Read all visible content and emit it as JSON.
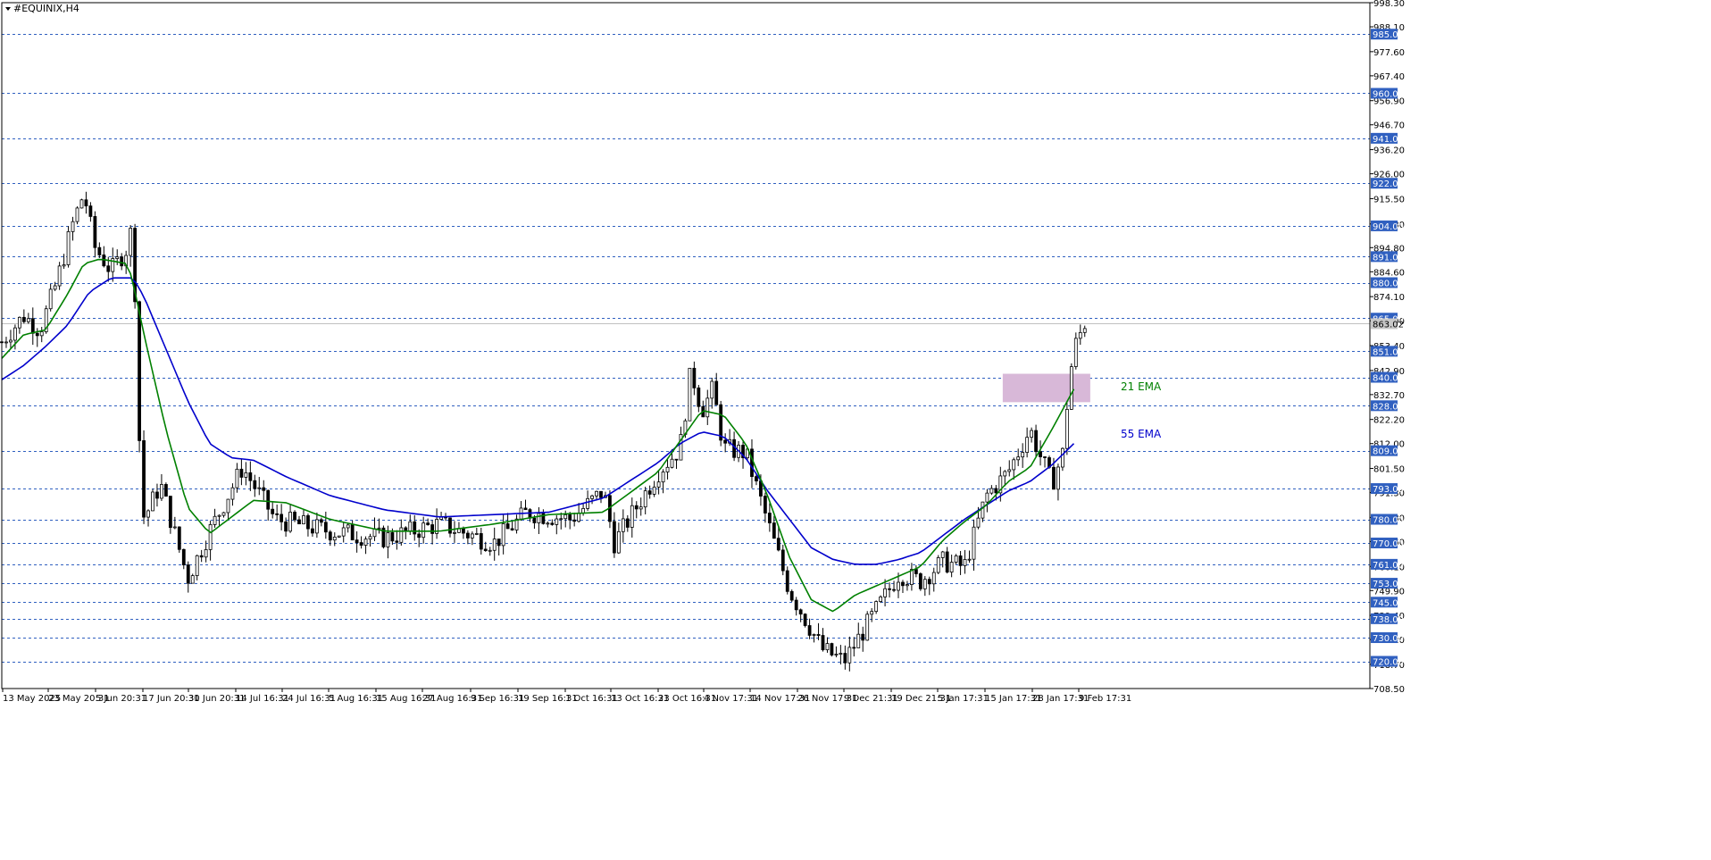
{
  "window": {
    "title": "#EQUINIX,H4"
  },
  "colors": {
    "background": "#ffffff",
    "grid_level": "#3060c0",
    "level_tag_bg": "#3060c0",
    "candle": "#000000",
    "ema21": "#008000",
    "ema55": "#0000cc",
    "zone": "#d8b8d8"
  },
  "chart_data": {
    "type": "candlestick",
    "symbol": "#EQUINIX",
    "timeframe": "H4",
    "ylim": [
      708.5,
      998.3
    ],
    "price_ticks": [
      "998.30",
      "988.10",
      "977.60",
      "967.40",
      "956.90",
      "946.70",
      "936.20",
      "926.00",
      "915.50",
      "904.80",
      "894.80",
      "884.60",
      "874.10",
      "863.90",
      "853.40",
      "842.90",
      "832.70",
      "822.20",
      "812.00",
      "801.50",
      "791.30",
      "780.80",
      "770.60",
      "760.10",
      "749.90",
      "739.40",
      "729.20",
      "718.70",
      "708.50"
    ],
    "price_tick_values": [
      998.3,
      988.1,
      977.6,
      967.4,
      956.9,
      946.7,
      936.2,
      926.0,
      915.5,
      904.8,
      894.8,
      884.6,
      874.1,
      863.9,
      853.4,
      842.9,
      832.7,
      822.2,
      812.0,
      801.5,
      791.3,
      780.8,
      770.6,
      760.1,
      749.9,
      739.4,
      729.2,
      718.7,
      708.5
    ],
    "levels": [
      "985.00",
      "960.00",
      "941.00",
      "922.00",
      "904.00",
      "891.00",
      "880.00",
      "865.00",
      "851.00",
      "840.00",
      "828.00",
      "809.00",
      "793.00",
      "780.00",
      "770.00",
      "761.00",
      "753.00",
      "745.00",
      "738.00",
      "730.00",
      "720.00"
    ],
    "level_values": [
      985,
      960,
      941,
      922,
      904,
      891,
      880,
      865,
      851,
      840,
      828,
      809,
      793,
      780,
      770,
      761,
      753,
      745,
      738,
      730,
      720
    ],
    "current_price": "863.02",
    "current_price_value": 863.02,
    "time_labels": [
      "13 May 2025",
      "23 May 20:31",
      "5 Jun 20:31",
      "17 Jun 20:31",
      "30 Jun 20:31",
      "14 Jul 16:31",
      "24 Jul 16:31",
      "5 Aug 16:31",
      "15 Aug 16:31",
      "27 Aug 16:31",
      "9 Sep 16:31",
      "19 Sep 16:31",
      "1 Oct 16:31",
      "13 Oct 16:31",
      "23 Oct 16:31",
      "4 Nov 17:31",
      "14 Nov 17:31",
      "26 Nov 17:31",
      "9 Dec 21:31",
      "19 Dec 21:31",
      "5 Jan 17:31",
      "15 Jan 17:31",
      "28 Jan 17:31",
      "9 Feb 17:31"
    ],
    "price_path": [
      [
        0,
        855
      ],
      [
        0.02,
        866
      ],
      [
        0.035,
        860
      ],
      [
        0.05,
        880
      ],
      [
        0.065,
        905
      ],
      [
        0.075,
        918
      ],
      [
        0.085,
        895
      ],
      [
        0.1,
        885
      ],
      [
        0.115,
        895
      ],
      [
        0.12,
        906
      ],
      [
        0.125,
        820
      ],
      [
        0.13,
        780
      ],
      [
        0.145,
        795
      ],
      [
        0.17,
        755
      ],
      [
        0.19,
        775
      ],
      [
        0.22,
        802
      ],
      [
        0.25,
        780
      ],
      [
        0.3,
        775
      ],
      [
        0.35,
        772
      ],
      [
        0.4,
        778
      ],
      [
        0.45,
        770
      ],
      [
        0.48,
        783
      ],
      [
        0.52,
        780
      ],
      [
        0.55,
        792
      ],
      [
        0.56,
        770
      ],
      [
        0.6,
        800
      ],
      [
        0.62,
        810
      ],
      [
        0.63,
        843
      ],
      [
        0.64,
        826
      ],
      [
        0.65,
        835
      ],
      [
        0.66,
        810
      ],
      [
        0.68,
        808
      ],
      [
        0.72,
        750
      ],
      [
        0.75,
        725
      ],
      [
        0.77,
        720
      ],
      [
        0.8,
        742
      ],
      [
        0.82,
        757
      ],
      [
        0.84,
        754
      ],
      [
        0.86,
        762
      ],
      [
        0.88,
        760
      ],
      [
        0.9,
        790
      ],
      [
        0.92,
        800
      ],
      [
        0.94,
        818
      ],
      [
        0.95,
        806
      ],
      [
        0.96,
        795
      ],
      [
        0.97,
        808
      ],
      [
        0.975,
        835
      ],
      [
        0.98,
        852
      ],
      [
        0.99,
        863
      ]
    ],
    "ema21_path": [
      [
        0,
        848
      ],
      [
        0.02,
        858
      ],
      [
        0.04,
        860
      ],
      [
        0.06,
        875
      ],
      [
        0.075,
        888
      ],
      [
        0.09,
        890
      ],
      [
        0.115,
        888
      ],
      [
        0.12,
        880
      ],
      [
        0.13,
        858
      ],
      [
        0.15,
        818
      ],
      [
        0.17,
        785
      ],
      [
        0.19,
        774
      ],
      [
        0.21,
        781
      ],
      [
        0.23,
        788
      ],
      [
        0.26,
        787
      ],
      [
        0.3,
        780
      ],
      [
        0.35,
        775
      ],
      [
        0.4,
        775
      ],
      [
        0.45,
        778
      ],
      [
        0.5,
        782
      ],
      [
        0.55,
        783
      ],
      [
        0.6,
        800
      ],
      [
        0.64,
        826
      ],
      [
        0.66,
        824
      ],
      [
        0.68,
        812
      ],
      [
        0.7,
        790
      ],
      [
        0.72,
        764
      ],
      [
        0.74,
        746
      ],
      [
        0.76,
        741
      ],
      [
        0.78,
        748
      ],
      [
        0.8,
        752
      ],
      [
        0.82,
        756
      ],
      [
        0.84,
        760
      ],
      [
        0.86,
        771
      ],
      [
        0.88,
        779
      ],
      [
        0.9,
        786
      ],
      [
        0.92,
        796
      ],
      [
        0.94,
        802
      ],
      [
        0.96,
        818
      ],
      [
        0.98,
        835
      ]
    ],
    "ema55_path": [
      [
        0,
        839
      ],
      [
        0.02,
        845
      ],
      [
        0.04,
        853
      ],
      [
        0.06,
        862
      ],
      [
        0.08,
        876
      ],
      [
        0.1,
        882
      ],
      [
        0.12,
        882
      ],
      [
        0.13,
        874
      ],
      [
        0.15,
        852
      ],
      [
        0.17,
        830
      ],
      [
        0.19,
        812
      ],
      [
        0.21,
        806
      ],
      [
        0.23,
        805
      ],
      [
        0.26,
        798
      ],
      [
        0.3,
        790
      ],
      [
        0.35,
        784
      ],
      [
        0.4,
        781
      ],
      [
        0.45,
        782
      ],
      [
        0.5,
        783
      ],
      [
        0.55,
        789
      ],
      [
        0.6,
        804
      ],
      [
        0.62,
        812
      ],
      [
        0.64,
        817
      ],
      [
        0.66,
        815
      ],
      [
        0.68,
        806
      ],
      [
        0.7,
        792
      ],
      [
        0.72,
        780
      ],
      [
        0.74,
        768
      ],
      [
        0.76,
        763
      ],
      [
        0.78,
        761
      ],
      [
        0.8,
        761
      ],
      [
        0.82,
        763
      ],
      [
        0.84,
        766
      ],
      [
        0.86,
        773
      ],
      [
        0.88,
        780
      ],
      [
        0.9,
        786
      ],
      [
        0.92,
        792
      ],
      [
        0.94,
        796
      ],
      [
        0.96,
        803
      ],
      [
        0.98,
        812
      ]
    ],
    "zone": {
      "low": 829.5,
      "high": 841.5,
      "x_start": 0.915,
      "x_end": 0.995
    },
    "annotations": [
      {
        "text": "21 EMA",
        "price": 836,
        "color": "#008000"
      },
      {
        "text": "55 EMA",
        "price": 816,
        "color": "#0000cc"
      }
    ]
  }
}
